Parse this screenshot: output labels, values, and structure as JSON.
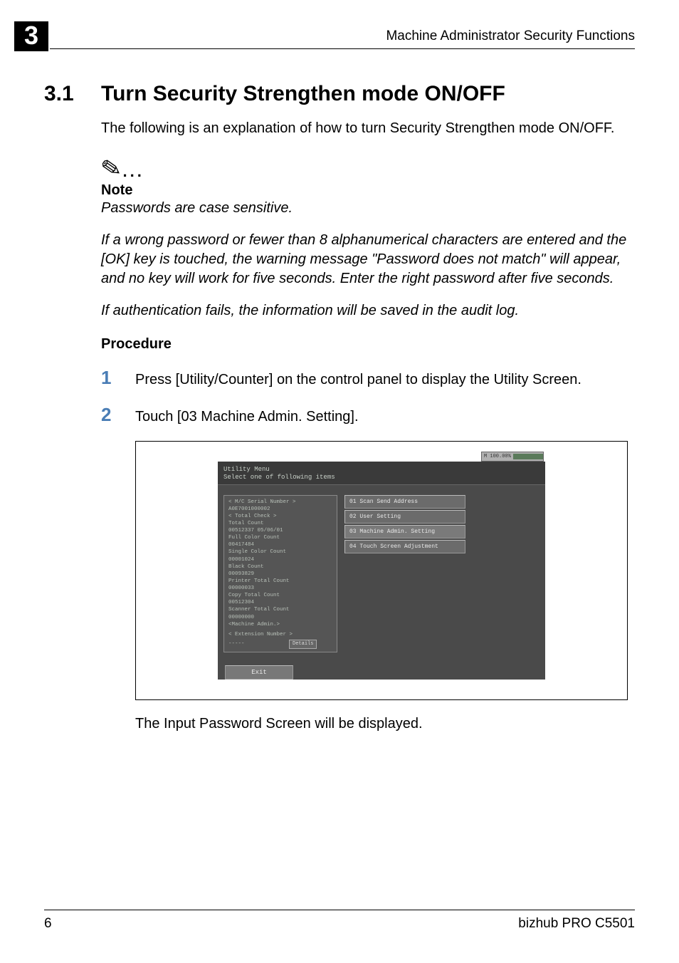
{
  "chapter_number": "3",
  "header_title": "Machine Administrator Security Functions",
  "section": {
    "number": "3.1",
    "title": "Turn Security Strengthen mode ON/OFF"
  },
  "intro": "The following is an explanation of how to turn Security Strengthen mode ON/OFF.",
  "note": {
    "label": "Note",
    "p1": "Passwords are case sensitive.",
    "p2": "If a wrong password or fewer than 8 alphanumerical characters are entered and the [OK] key is touched, the warning message \"Password does not match\" will appear, and no key will work for five seconds. Enter the right password after five seconds.",
    "p3": "If authentication fails, the information will be saved in the audit log."
  },
  "procedure_label": "Procedure",
  "steps": {
    "s1": {
      "num": "1",
      "text": "Press [Utility/Counter] on the control panel to display the Utility Screen."
    },
    "s2": {
      "num": "2",
      "text": "Touch [03 Machine Admin. Setting]."
    }
  },
  "screen": {
    "mem_label": "M 100.00%",
    "util_title": "Utility Menu",
    "util_sub": "Select one of following items",
    "left": {
      "l1": "< M/C Serial Number >",
      "l2": "  A0E7001000002",
      "l3": "< Total Check >",
      "l4": "Total Count",
      "l5": "  00512337      05/06/01",
      "l6": "Full Color Count",
      "l7": "  00417484",
      "l8": "Single Color Count",
      "l9": "  00001024",
      "l10": "Black Count",
      "l11": "  00093829",
      "l12": "Printer Total Count",
      "l13": "  00000033",
      "l14": "Copy Total Count",
      "l15": "  00512304",
      "l16": "Scanner Total Count",
      "l17": "  00000000",
      "l18": "<Machine Admin.>",
      "l19": "< Extension Number >",
      "l20": "  -----",
      "details": "Details"
    },
    "menu": {
      "m1": "01 Scan Send Address",
      "m2": "02 User Setting",
      "m3": "03 Machine Admin. Setting",
      "m4": "04 Touch Screen Adjustment"
    },
    "exit": "Exit"
  },
  "after_screen": "The Input Password Screen will be displayed.",
  "footer": {
    "page": "6",
    "model": "bizhub PRO C5501"
  }
}
